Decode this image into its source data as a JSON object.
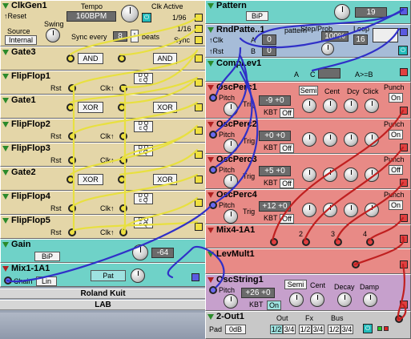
{
  "modules": {
    "clkgen": {
      "title": "ClkGen1",
      "reset": "↑Reset",
      "swing": "Swing",
      "source_label": "Source",
      "source_value": "Internal",
      "tempo_label": "Tempo",
      "tempo_value": "160BPM",
      "clk_label": "Clk Active",
      "div1": "1/96",
      "div2": "1/16",
      "sync_label": "Sync every",
      "sync_value": "8",
      "beats": "beats",
      "sync_out": "Sync"
    },
    "gate3": {
      "title": "Gate3",
      "op1": "AND",
      "op2": "AND"
    },
    "flipflop1": {
      "title": "FlipFlop1",
      "rst": "Rst",
      "clk": "Clk↑"
    },
    "gate1": {
      "title": "Gate1",
      "op1": "XOR",
      "op2": "XOR"
    },
    "flipflop2": {
      "title": "FlipFlop2",
      "rst": "Rst",
      "clk": "Clk↑"
    },
    "flipflop3": {
      "title": "FlipFlop3",
      "rst": "Rst",
      "clk": "Clk↑"
    },
    "gate2": {
      "title": "Gate2",
      "op1": "XOR",
      "op2": "XOR"
    },
    "flipflop4": {
      "title": "FlipFlop4",
      "rst": "Rst",
      "clk": "Clk↑"
    },
    "flipflop5": {
      "title": "FlipFlop5",
      "rst": "Rst",
      "clk": "Clk↑"
    },
    "gain": {
      "title": "Gain",
      "mode": "BiP",
      "value": "-64"
    },
    "mix": {
      "title": "Mix1-1A1",
      "chain": "Chain",
      "lin": "Lin",
      "pat": "Pat"
    },
    "pattern": {
      "title": "Pattern",
      "mode": "BiP",
      "value": "19"
    },
    "rndpattern": {
      "title": "RndPatte..1",
      "pattern": "pattern",
      "step_prob": "Step/Prob",
      "loop": "Loop",
      "clk": "↑Clk",
      "rst": "↑Rst",
      "a_val": "0",
      "b_val": "0",
      "pct": "100%",
      "loop_value": "16",
      "a": "A",
      "b": "B"
    },
    "complev": {
      "title": "CompLev1",
      "a": "A",
      "c": "C",
      "a_gt_b": "A>=B"
    },
    "osc1": {
      "title": "OscPerc1",
      "pitch": "Pitch",
      "trig": "Trig",
      "val1": "-9",
      "val2": "+0",
      "kbt": "KBT",
      "kbt_state": "Off",
      "semi": "Semi",
      "cent": "Cent",
      "dcy": "Dcy",
      "click": "Click",
      "punch": "Punch",
      "punch_state": "On"
    },
    "osc2": {
      "title": "OscPerc2",
      "pitch": "Pitch",
      "trig": "Trig",
      "val1": "+0",
      "val2": "+0",
      "kbt": "KBT",
      "kbt_state": "Off",
      "punch": "Punch",
      "punch_state": "On"
    },
    "osc3": {
      "title": "OscPerc3",
      "pitch": "Pitch",
      "trig": "Trig",
      "val1": "+5",
      "val2": "+0",
      "kbt": "KBT",
      "kbt_state": "Off",
      "punch": "Punch",
      "punch_state": "Off"
    },
    "osc4": {
      "title": "OscPerc4",
      "pitch": "Pitch",
      "trig": "Trig",
      "val1": "+12",
      "val2": "+0",
      "kbt": "KBT",
      "kbt_state": "Off",
      "punch": "Punch",
      "punch_state": "On"
    },
    "mix4": {
      "title": "Mix4-1A1",
      "ch2": "2",
      "ch3": "3",
      "ch4": "4"
    },
    "levmult": {
      "title": "LevMult1"
    },
    "string": {
      "title": "OscString1",
      "pitch": "Pitch",
      "val1": "+26",
      "val2": "+0",
      "kbt": "KBT",
      "kbt_state": "On",
      "semi": "Semi",
      "cent": "Cent",
      "decay": "Decay",
      "damp": "Damp"
    },
    "out": {
      "title": "2-Out1",
      "pad": "Pad",
      "pad_value": "0dB",
      "out": "Out",
      "fx": "Fx",
      "bus": "Bus",
      "b12": "1/2",
      "b34": "3/4"
    }
  },
  "footer": {
    "author": "Roland Kuit",
    "lab": "LAB"
  },
  "colors": {
    "tan": "#e4d6a8",
    "teal": "#6fd2c8",
    "salmon": "#e88a86",
    "lilac": "#c6a0cc",
    "cable_yellow": "#e8e040",
    "cable_blue": "#3030c8",
    "cable_red": "#c02020"
  }
}
